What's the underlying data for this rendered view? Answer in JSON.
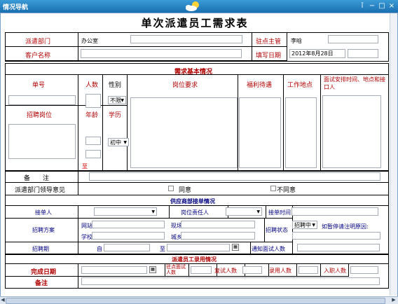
{
  "window": {
    "title": "情况导航"
  },
  "doc": {
    "title": "单次派遣员工需求表"
  },
  "top": {
    "dept_label": "派遣部门",
    "dept_value": "办公室",
    "supervisor_label": "驻点主管",
    "supervisor_value": "李晗",
    "client_label": "客户名称",
    "client_value": "",
    "date_label": "填写日期",
    "date_value": "2012年8月28日"
  },
  "basic": {
    "section": "需求基本情况",
    "col_no": "单号",
    "col_count": "人数",
    "col_gender": "性别",
    "col_req": "岗位要求",
    "col_welfare": "福利待遇",
    "col_place": "工作地点",
    "col_interview": "面试安排时间、地点和接口人",
    "col_post": "招聘岗位",
    "col_age": "年龄",
    "col_edu": "学历",
    "gender_value": "不限",
    "edu_value": "初中",
    "to_label": "至"
  },
  "remark": {
    "label": "备　　注"
  },
  "opinion": {
    "label": "派遣部门领导意见",
    "agree": "同意",
    "disagree": "不同意"
  },
  "supplier": {
    "section": "供应商部接单情况",
    "receiver": "接单人",
    "owner": "岗位责任人",
    "receive_time": "接单时间",
    "plan": "招聘方案",
    "website": "网站",
    "field": "现场",
    "school": "学校",
    "city": "城乡",
    "status": "招聘状态",
    "status_value": "招聘中",
    "pause_note": "如暂停请注明原因:",
    "period": "招聘期",
    "from": "自",
    "to": "至",
    "notify": "通知面试人数"
  },
  "hire": {
    "section": "派遣员工录用情况",
    "finish_date": "完成日期",
    "onsite_count": "驻点面试人数",
    "reinterview": "复试人数",
    "hired": "录用人数",
    "joined": "入职人数",
    "note": "备注"
  }
}
